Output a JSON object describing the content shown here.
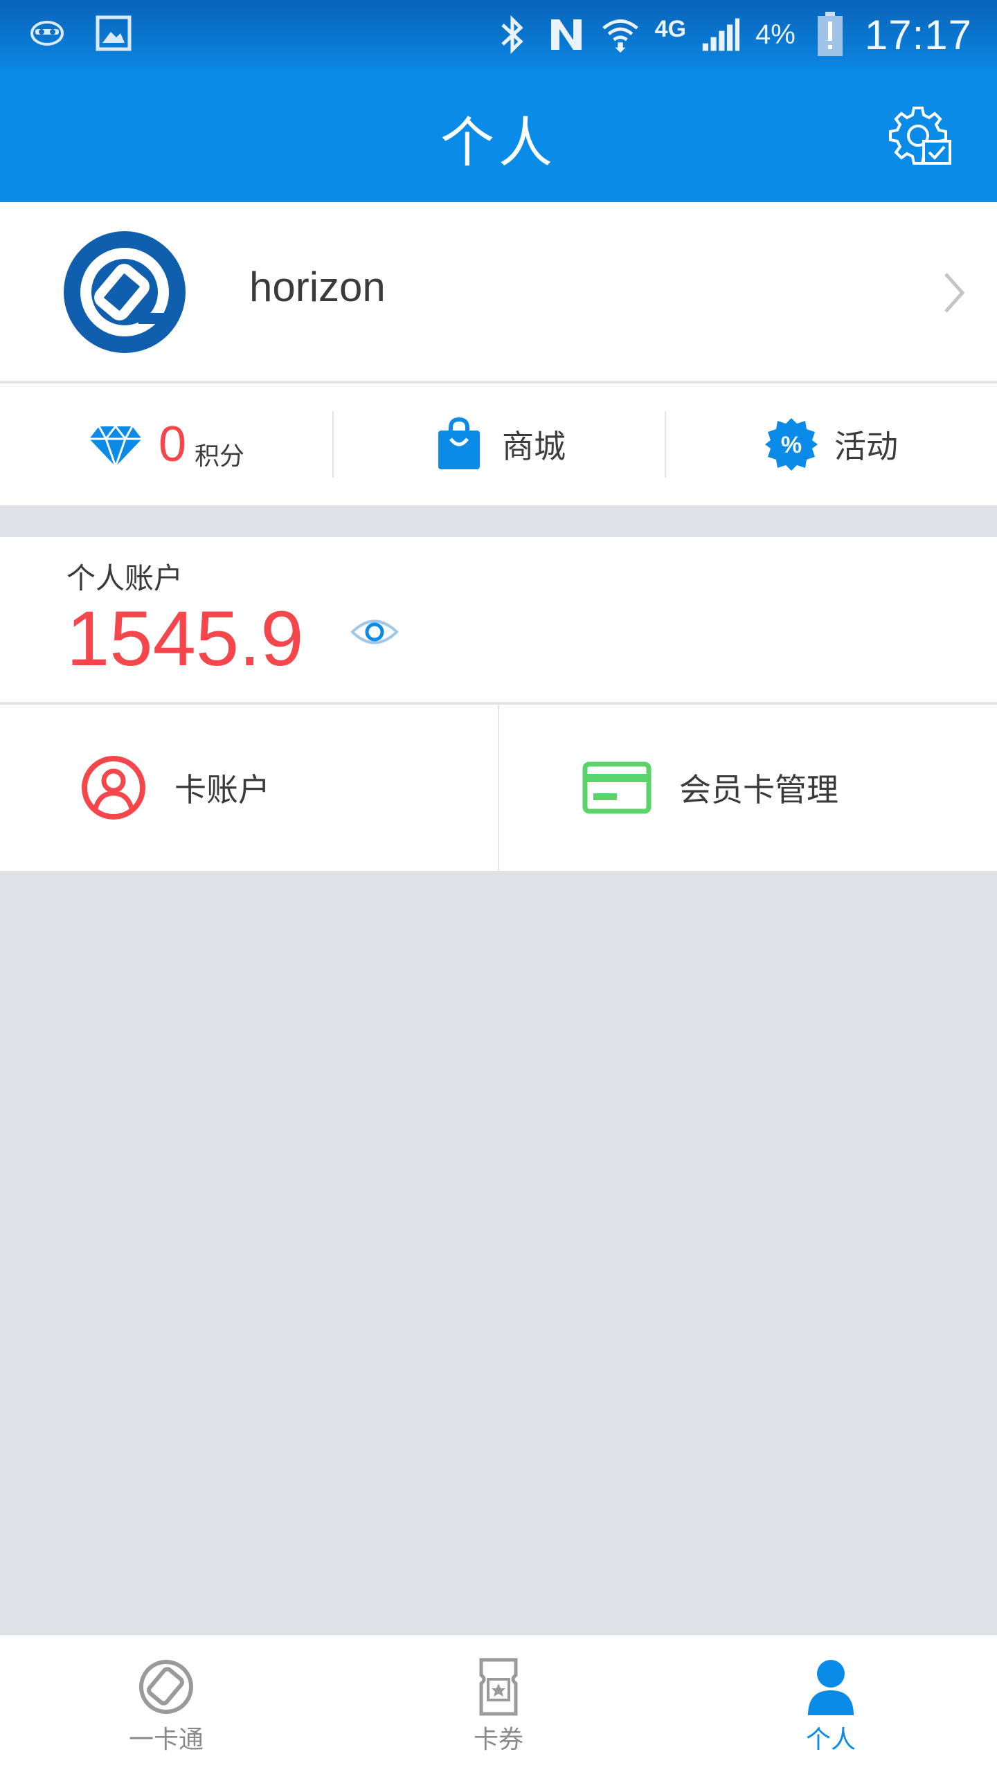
{
  "status_bar": {
    "network": "4G",
    "battery": "4%",
    "time": "17:17"
  },
  "header": {
    "title": "个人"
  },
  "profile": {
    "username": "horizon"
  },
  "quick_links": {
    "points_value": "0",
    "points_label": "积分",
    "mall_label": "商城",
    "activity_label": "活动"
  },
  "account": {
    "label": "个人账户",
    "balance": "1545.9"
  },
  "cards": {
    "card_account_label": "卡账户",
    "member_card_label": "会员卡管理"
  },
  "bottom_nav": {
    "tabs": [
      {
        "label": "一卡通",
        "active": false
      },
      {
        "label": "卡券",
        "active": false
      },
      {
        "label": "个人",
        "active": true
      }
    ]
  },
  "colors": {
    "brand_blue": "#0b8be8",
    "accent_red": "#f5464b",
    "accent_green": "#5bd36b"
  }
}
